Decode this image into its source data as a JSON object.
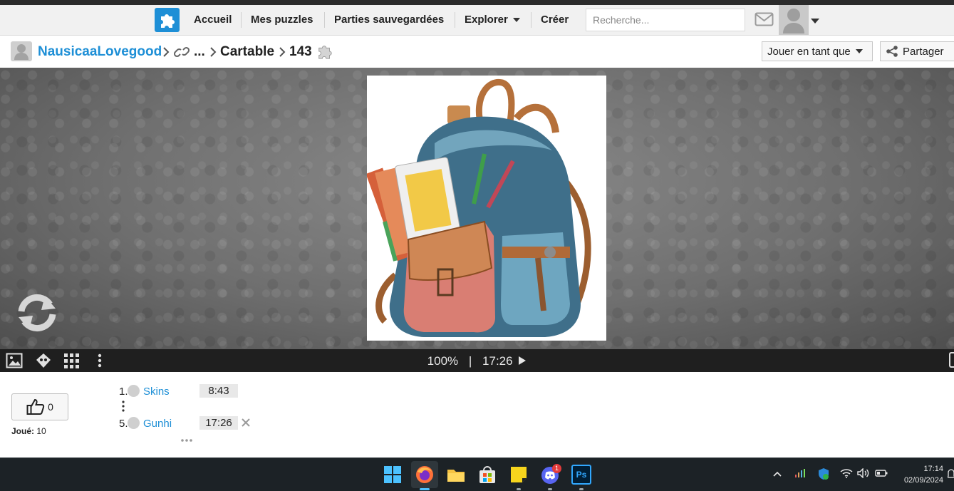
{
  "navbar": {
    "items": [
      {
        "label": "Accueil"
      },
      {
        "label": "Mes puzzles"
      },
      {
        "label": "Parties sauvegardées"
      },
      {
        "label": "Explorer"
      },
      {
        "label": "Créer"
      }
    ],
    "search_placeholder": "Recherche..."
  },
  "breadcrumb": {
    "user": "NausicaaLovegood",
    "ellipsis": "...",
    "album": "Cartable",
    "piece_count": "143"
  },
  "actions": {
    "play_as": "Jouer en tant que",
    "share": "Partager"
  },
  "toolbar": {
    "zoom": "100%",
    "separator": "|",
    "timer": "17:26"
  },
  "stats": {
    "likes": "0",
    "played_label": "Joué:",
    "played_count": "10"
  },
  "scores": [
    {
      "rank": "1.",
      "name": "Skins",
      "time": "8:43"
    },
    {
      "rank": "5.",
      "name": "Gunhi",
      "time": "17:26"
    }
  ],
  "taskbar": {
    "discord_badge": "1",
    "ps_label": "Ps",
    "clock_time": "17:14",
    "clock_date": "02/09/2024"
  },
  "colors": {
    "accent_blue": "#1e8fd6",
    "toolbar_bg": "#1f1f1f",
    "taskbar_bg": "#1c2226"
  }
}
